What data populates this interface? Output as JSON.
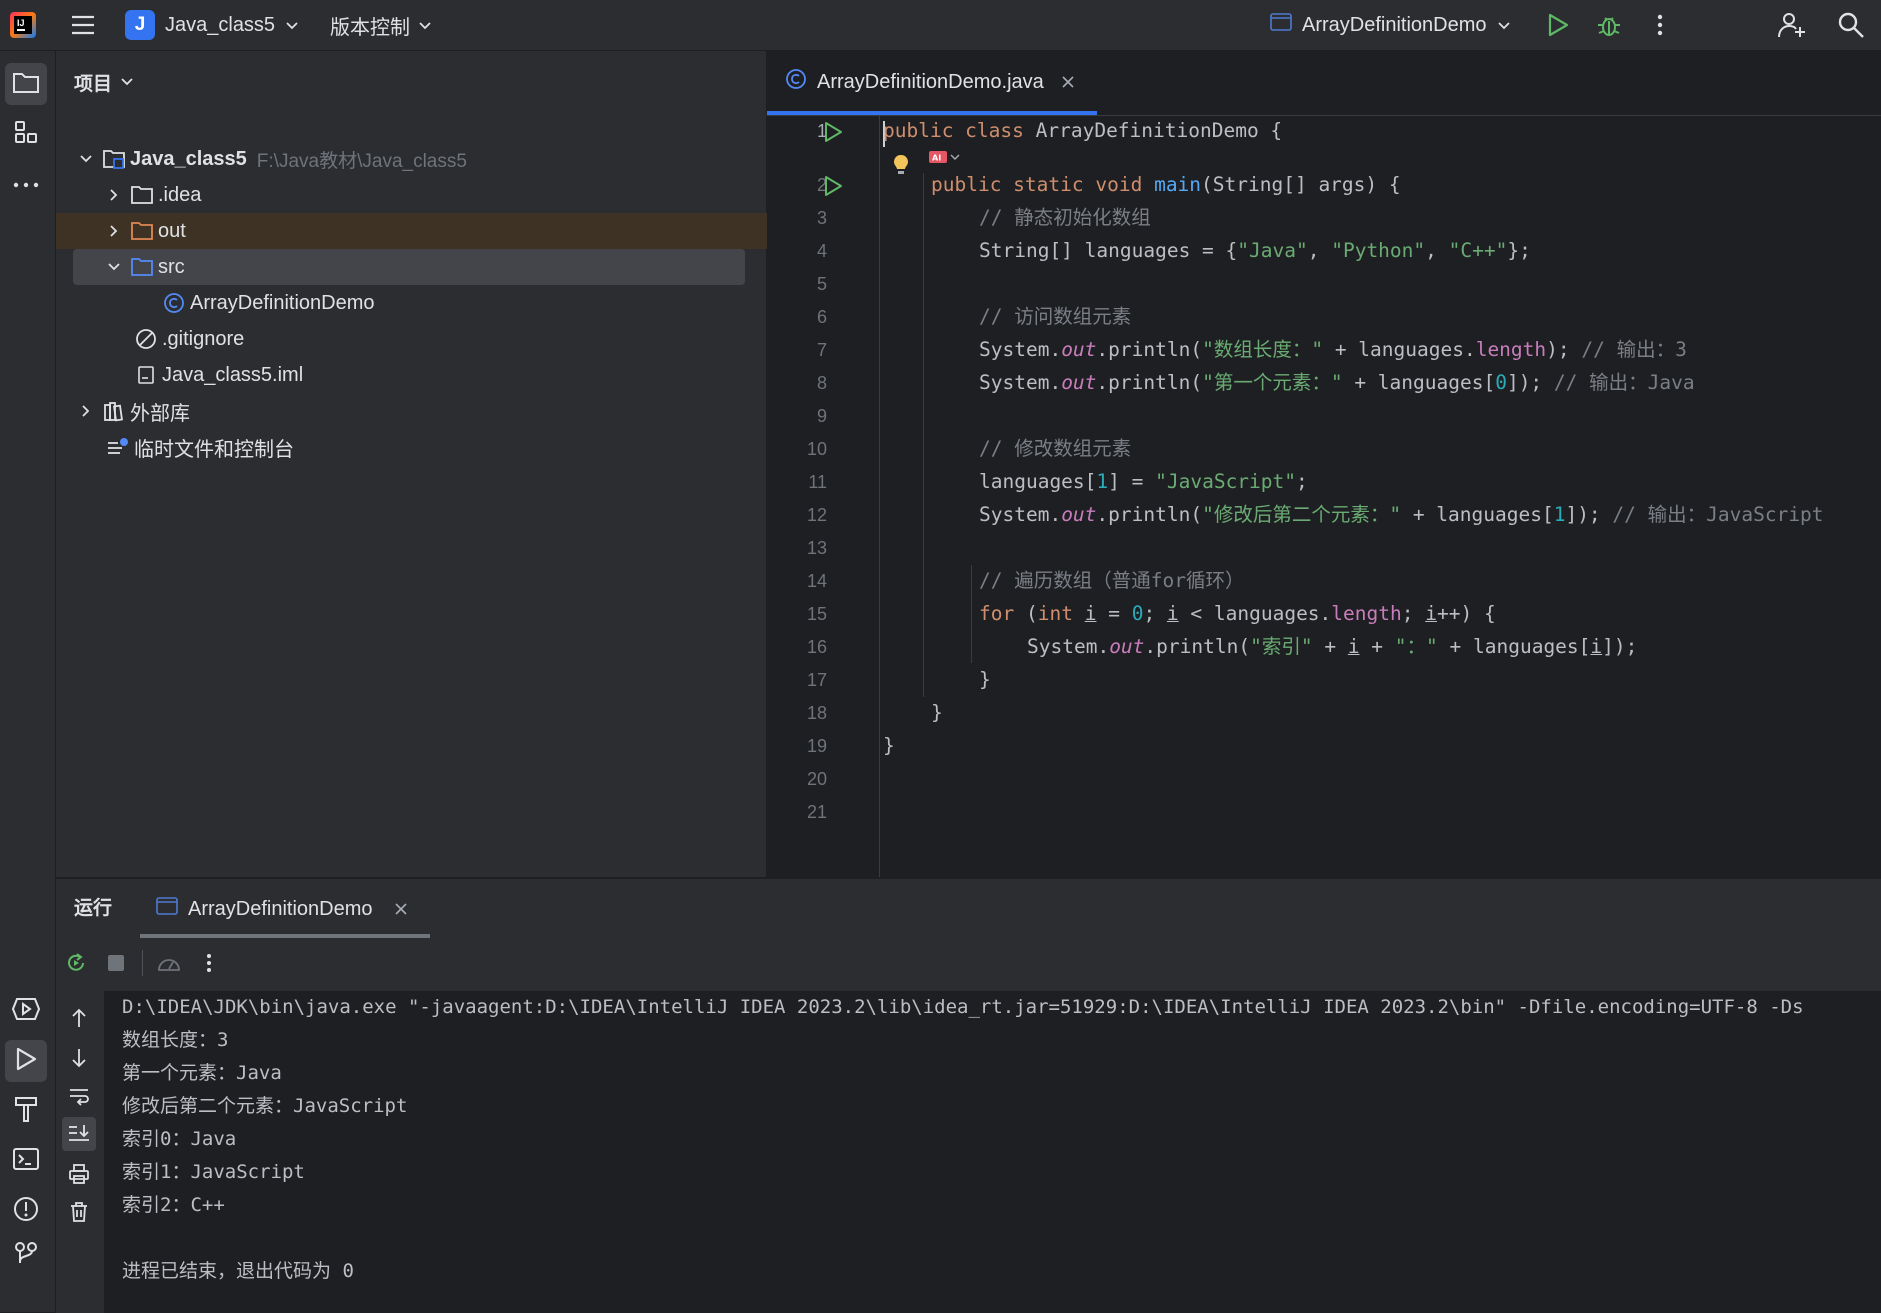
{
  "titlebar": {
    "project_letter": "J",
    "project_name": "Java_class5",
    "vcs_label": "版本控制",
    "run_config": "ArrayDefinitionDemo"
  },
  "project_panel": {
    "title": "项目",
    "tree": [
      {
        "label": "Java_class5",
        "hint": "F:\\Java教材\\Java_class5"
      },
      {
        "label": ".idea"
      },
      {
        "label": "out"
      },
      {
        "label": "src"
      },
      {
        "label": "ArrayDefinitionDemo"
      },
      {
        "label": ".gitignore"
      },
      {
        "label": "Java_class5.iml"
      },
      {
        "label": "外部库"
      },
      {
        "label": "临时文件和控制台"
      }
    ]
  },
  "editor": {
    "tab_label": "ArrayDefinitionDemo.java",
    "line_numbers": [
      "1",
      "2",
      "3",
      "4",
      "5",
      "6",
      "7",
      "8",
      "9",
      "10",
      "11",
      "12",
      "13",
      "14",
      "15",
      "16",
      "17",
      "18",
      "19",
      "20",
      "21"
    ],
    "code": {
      "l1_kw": "public class",
      "l1_rest": " ArrayDefinitionDemo {",
      "l2_kw": "public static void",
      "l2_fn": "main",
      "l2_rest": "(String[] args) {",
      "l3": "// 静态初始化数组",
      "l4_a": "String[] languages = {",
      "l4_s1": "\"Java\"",
      "l4_s2": "\"Python\"",
      "l4_s3": "\"C++\"",
      "l6": "// 访问数组元素",
      "l7_str": "\"数组长度：\"",
      "l7_cm": "// 输出：3",
      "l8_str": "\"第一个元素：\"",
      "l8_num": "0",
      "l8_cm": "// 输出：Java",
      "l10": "// 修改数组元素",
      "l11_num": "1",
      "l11_str": "\"JavaScript\"",
      "l12_str": "\"修改后第二个元素：\"",
      "l12_num": "1",
      "l12_cm": "// 输出：JavaScript",
      "l14": "// 遍历数组（普通for循环）",
      "l15_for": "for",
      "l15_int": "int",
      "l15_num": "0",
      "l16_s1": "\"索引\"",
      "l16_s2": "\"：\""
    }
  },
  "run_panel": {
    "title": "运行",
    "tab_label": "ArrayDefinitionDemo",
    "console": [
      "D:\\IDEA\\JDK\\bin\\java.exe \"-javaagent:D:\\IDEA\\IntelliJ IDEA 2023.2\\lib\\idea_rt.jar=51929:D:\\IDEA\\IntelliJ IDEA 2023.2\\bin\" -Dfile.encoding=UTF-8 -Ds",
      "数组长度：3",
      "第一个元素：Java",
      "修改后第二个元素：JavaScript",
      "索引0：Java",
      "索引1：JavaScript",
      "索引2：C++",
      "",
      "进程已结束，退出代码为 0"
    ]
  },
  "colors": {
    "accent": "#3574f0",
    "run_green": "#5fb865",
    "keyword": "#cf8e6d",
    "string": "#6aab73",
    "number": "#2aacb8",
    "comment": "#7a7e85",
    "field": "#c77dbb",
    "function": "#56a8f5"
  },
  "icons": [
    "app-logo-icon",
    "hamburger-menu-icon",
    "chevron-down-icon",
    "run-icon",
    "debug-icon",
    "more-vertical-icon",
    "add-user-icon",
    "search-icon",
    "folder-icon",
    "structure-icon",
    "more-horizontal-icon",
    "java-class-icon",
    "gitignore-icon",
    "iml-file-icon",
    "library-icon",
    "scratch-icon",
    "services-icon",
    "terminal-icon",
    "problems-icon",
    "git-icon",
    "build-icon",
    "rerun-icon",
    "stop-icon",
    "profile-icon",
    "arrow-up-icon",
    "arrow-down-icon",
    "soft-wrap-icon",
    "scroll-to-end-icon",
    "print-icon",
    "trash-icon",
    "lightbulb-icon",
    "ai-icon",
    "close-icon"
  ]
}
